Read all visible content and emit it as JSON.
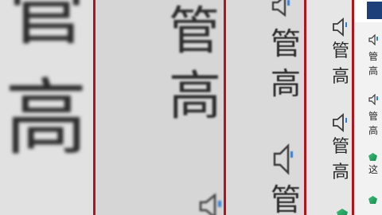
{
  "colors": {
    "divider": "#b3141c",
    "text": "#2b2b2b",
    "accent_blue": "#2f7fd8",
    "gem_green": "#1f9e5a"
  },
  "zoom_level_1": {
    "line1": "管",
    "line2": "高"
  },
  "zoom_level_2": {
    "line1": "管",
    "line2": "高",
    "speaker_icon": "speaker-icon"
  },
  "zoom_level_3": {
    "line1": "管",
    "line2": "高",
    "line3": "管"
  },
  "zoom_level_4": {
    "line1": "管",
    "line2": "高",
    "line3": "管",
    "line4": "高"
  },
  "notification_list": {
    "items": [
      {
        "line1": "管",
        "line2": "高",
        "icon": "speaker-icon"
      },
      {
        "line1": "管",
        "line2": "高",
        "icon": "speaker-icon"
      },
      {
        "line1": "这",
        "icon": "gem-icon"
      },
      {
        "line1": "",
        "icon": "gem-icon"
      }
    ]
  }
}
